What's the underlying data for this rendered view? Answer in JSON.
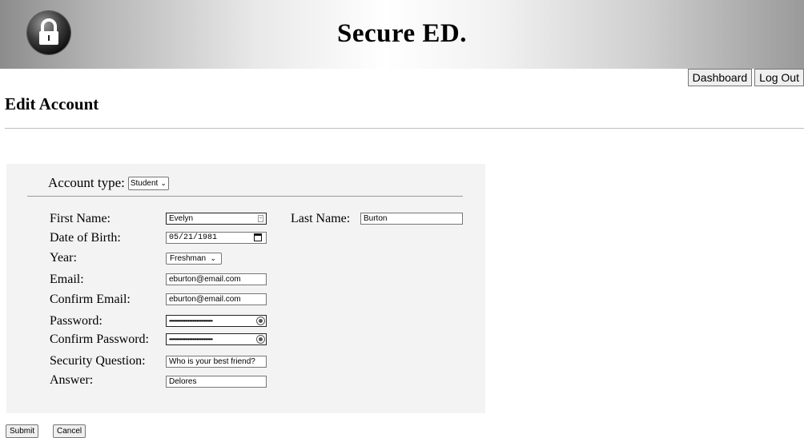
{
  "header": {
    "brand_title": "Secure ED.",
    "logo_icon": "padlock-icon",
    "nav": {
      "dashboard_label": "Dashboard",
      "logout_label": "Log Out"
    }
  },
  "page": {
    "title": "Edit Account"
  },
  "form": {
    "account_type_label": "Account type:",
    "account_type_value": "Student",
    "first_name_label": "First Name:",
    "first_name_value": "Evelyn",
    "last_name_label": "Last Name:",
    "last_name_value": "Burton",
    "dob_label": "Date of Birth:",
    "dob_value": "05/21/1981",
    "year_label": "Year:",
    "year_value": "Freshman",
    "email_label": "Email:",
    "email_value": "eburton@email.com",
    "confirm_email_label": "Confirm Email:",
    "confirm_email_value": "eburton@email.com",
    "password_label": "Password:",
    "password_mask": "••••••••••••••••••••••••••••••",
    "confirm_password_label": "Confirm Password:",
    "confirm_password_mask": "••••••••••••••••••••••••••••••",
    "security_question_label": "Security Question:",
    "security_question_value": "Who is your best friend?",
    "answer_label": "Answer:",
    "answer_value": "Delores"
  },
  "actions": {
    "submit_label": "Submit",
    "cancel_label": "Cancel"
  }
}
